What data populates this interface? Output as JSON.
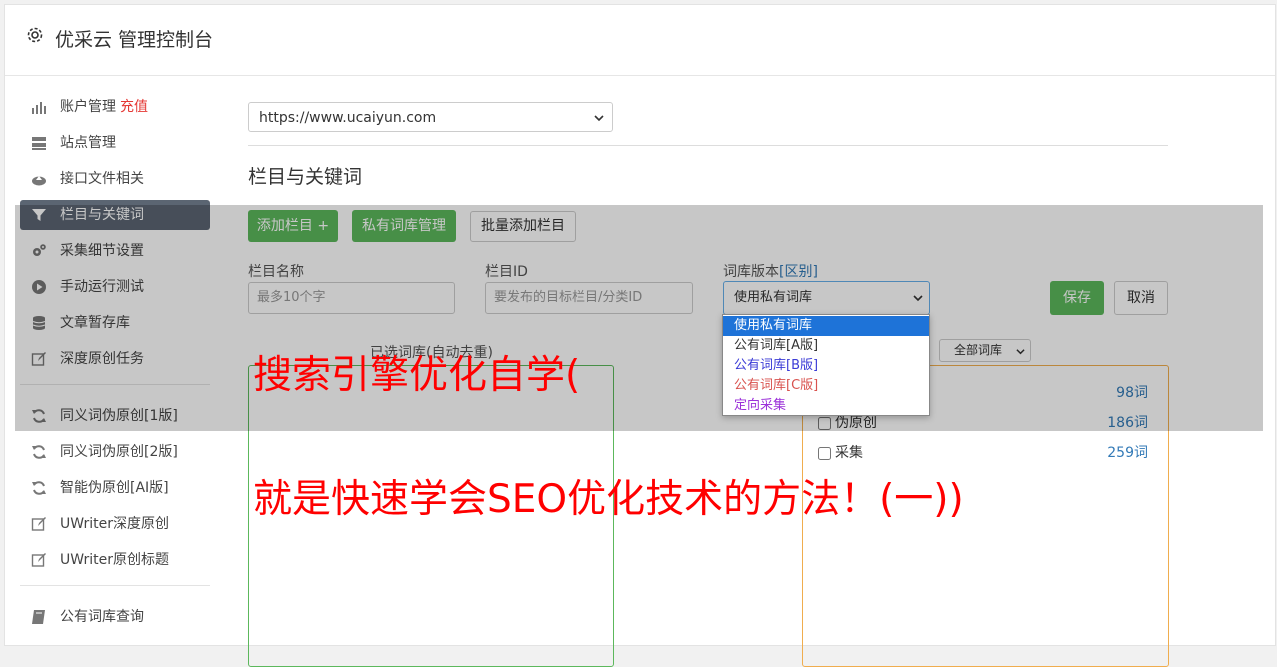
{
  "header": {
    "title": "优采云 管理控制台"
  },
  "sidebar": {
    "items": [
      {
        "label": "账户管理",
        "badge": "充值",
        "icon": "bar-chart-icon"
      },
      {
        "label": "站点管理",
        "icon": "server-icon"
      },
      {
        "label": "接口文件相关",
        "icon": "cloud-upload-icon"
      },
      {
        "label": "栏目与关键词",
        "icon": "filter-icon"
      },
      {
        "label": "采集细节设置",
        "icon": "gears-icon"
      },
      {
        "label": "手动运行测试",
        "icon": "play-circle-icon"
      },
      {
        "label": "文章暂存库",
        "icon": "database-icon"
      },
      {
        "label": "深度原创任务",
        "icon": "edit-icon"
      },
      {
        "label": "同义词伪原创[1版]",
        "icon": "refresh-icon"
      },
      {
        "label": "同义词伪原创[2版]",
        "icon": "refresh-icon"
      },
      {
        "label": "智能伪原创[AI版]",
        "icon": "refresh-icon"
      },
      {
        "label": "UWriter深度原创",
        "icon": "edit-icon"
      },
      {
        "label": "UWriter原创标题",
        "icon": "edit-icon"
      },
      {
        "label": "公有词库查询",
        "icon": "book-icon"
      }
    ]
  },
  "main": {
    "site_select": "https://www.ucaiyun.com",
    "section_title": "栏目与关键词",
    "buttons": {
      "add_column": "添加栏目 +",
      "private_lib": "私有词库管理",
      "batch_add": "批量添加栏目",
      "save": "保存",
      "cancel": "取消"
    },
    "form": {
      "name_label": "栏目名称",
      "name_placeholder": "最多10个字",
      "id_label": "栏目ID",
      "id_placeholder": "要发布的目标栏目/分类ID",
      "version_label": "词库版本",
      "version_link": "[区别]",
      "version_value": "使用私有词库"
    },
    "dropdown_options": [
      {
        "label": "使用私有词库",
        "color": "#ffffff"
      },
      {
        "label": "公有词库[A版]",
        "color": "#333333"
      },
      {
        "label": "公有词库[B版]",
        "color": "#3b3bd6"
      },
      {
        "label": "公有词库[C版]",
        "color": "#d9534f"
      },
      {
        "label": "定向采集",
        "color": "#9b30d9"
      }
    ],
    "selected_lib_label": "已选词库(自动去重)",
    "all_lib_select": "全部词库",
    "categories": [
      {
        "label": "",
        "count": "98词"
      },
      {
        "label": "伪原创",
        "count": "186词"
      },
      {
        "label": "采集",
        "count": "259词"
      }
    ]
  },
  "banner": {
    "line1": "搜索引擎优化自学(",
    "line2": "就是快速学会SEO优化技术的方法！(一))"
  }
}
